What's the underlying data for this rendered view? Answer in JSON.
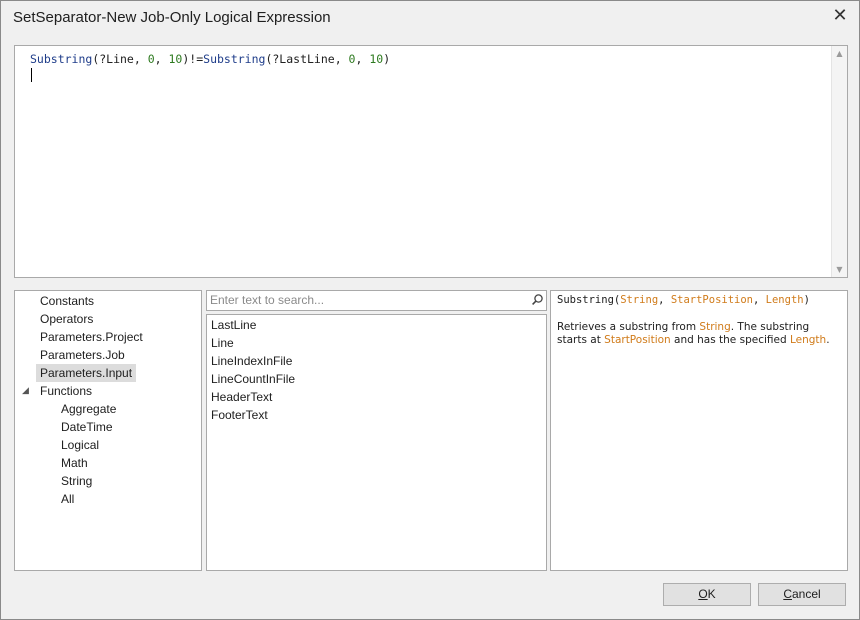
{
  "window": {
    "title": "SetSeparator-New Job-Only Logical Expression",
    "close_glyph": "✕"
  },
  "editor": {
    "tokens": [
      {
        "type": "fn",
        "text": "Substring"
      },
      {
        "type": "op",
        "text": "(?Line, "
      },
      {
        "type": "num",
        "text": "0"
      },
      {
        "type": "op",
        "text": ", "
      },
      {
        "type": "num",
        "text": "10"
      },
      {
        "type": "op",
        "text": ")!="
      },
      {
        "type": "fn",
        "text": "Substring"
      },
      {
        "type": "op",
        "text": "(?LastLine, "
      },
      {
        "type": "num",
        "text": "0"
      },
      {
        "type": "op",
        "text": ", "
      },
      {
        "type": "num",
        "text": "10"
      },
      {
        "type": "op",
        "text": ")"
      }
    ],
    "scroll_up_glyph": "▲",
    "scroll_down_glyph": "▼"
  },
  "tree": {
    "items": [
      {
        "label": "Constants",
        "level": 0
      },
      {
        "label": "Operators",
        "level": 0
      },
      {
        "label": "Parameters.Project",
        "level": 0
      },
      {
        "label": "Parameters.Job",
        "level": 0
      },
      {
        "label": "Parameters.Input",
        "level": 0,
        "selected": true
      },
      {
        "label": "Functions",
        "level": 0,
        "expanded": true
      },
      {
        "label": "Aggregate",
        "level": 1
      },
      {
        "label": "DateTime",
        "level": 1
      },
      {
        "label": "Logical",
        "level": 1
      },
      {
        "label": "Math",
        "level": 1
      },
      {
        "label": "String",
        "level": 1
      },
      {
        "label": "All",
        "level": 1
      }
    ],
    "expander_glyph": "◢"
  },
  "search": {
    "placeholder": "Enter text to search...",
    "icon": "search-icon"
  },
  "list": {
    "items": [
      "LastLine",
      "Line",
      "LineIndexInFile",
      "LineCountInFile",
      "HeaderText",
      "FooterText"
    ]
  },
  "description": {
    "signature": [
      {
        "type": "text",
        "text": "Substring("
      },
      {
        "type": "param",
        "text": "String"
      },
      {
        "type": "text",
        "text": ", "
      },
      {
        "type": "param",
        "text": "StartPosition"
      },
      {
        "type": "text",
        "text": ", "
      },
      {
        "type": "param",
        "text": "Length"
      },
      {
        "type": "text",
        "text": ")"
      }
    ],
    "body": [
      {
        "type": "text",
        "text": "Retrieves a substring from "
      },
      {
        "type": "param",
        "text": "String"
      },
      {
        "type": "text",
        "text": ". The substring starts at "
      },
      {
        "type": "param",
        "text": "StartPosition"
      },
      {
        "type": "text",
        "text": " and has the specified "
      },
      {
        "type": "param",
        "text": "Length"
      },
      {
        "type": "text",
        "text": "."
      }
    ]
  },
  "buttons": {
    "ok": {
      "underlined": "O",
      "rest": "K"
    },
    "cancel": {
      "underlined": "C",
      "rest": "ancel"
    }
  },
  "colors": {
    "function": "#1f3d8a",
    "number": "#2d7a1f",
    "param": "#d07b1a",
    "selected_bg": "#dcdcdc"
  }
}
